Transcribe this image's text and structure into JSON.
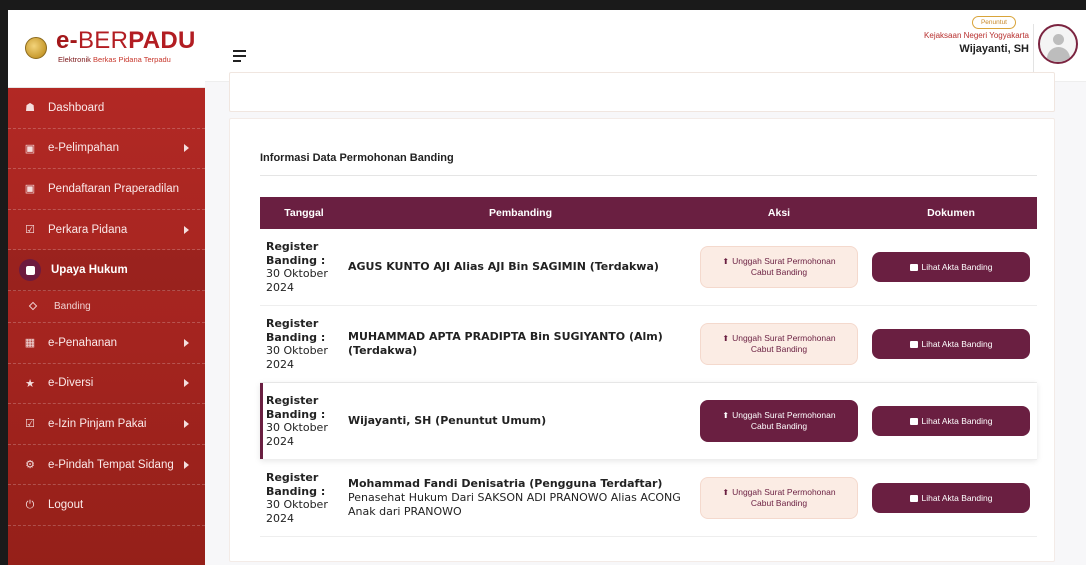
{
  "brand": {
    "title_pre": "e-",
    "title_mid": "BER",
    "title_end": "PADU",
    "subtitle_part1": "Elektronik ",
    "subtitle_part2": "Berkas Pidana Terpadu"
  },
  "sidebar": {
    "items": [
      {
        "label": "Dashboard",
        "icon": "home-icon"
      },
      {
        "label": "e-Pelimpahan",
        "icon": "file-icon"
      },
      {
        "label": "Pendaftaran Praperadilan",
        "icon": "file-icon"
      },
      {
        "label": "Perkara Pidana",
        "icon": "check-icon"
      },
      {
        "label": "Upaya Hukum",
        "icon": "file-icon"
      },
      {
        "label": "Banding",
        "icon": "diamond-icon"
      },
      {
        "label": "e-Penahanan",
        "icon": "grid-icon"
      },
      {
        "label": "e-Diversi",
        "icon": "star-icon"
      },
      {
        "label": "e-Izin Pinjam Pakai",
        "icon": "check-icon"
      },
      {
        "label": "e-Pindah Tempat Sidang",
        "icon": "gear-icon"
      },
      {
        "label": "Logout",
        "icon": "power-icon"
      }
    ]
  },
  "header": {
    "role": "Penuntut",
    "org": "Kejaksaan Negeri Yogyakarta",
    "user": "Wijayanti, SH"
  },
  "main": {
    "section_title": "Informasi Data Permohonan Banding",
    "columns": [
      "Tanggal",
      "Pembanding",
      "Aksi",
      "Dokumen"
    ],
    "rows": [
      {
        "date_label": "Register Banding :",
        "date": "30 Oktober 2024",
        "name": "AGUS KUNTO AJI Alias AJI Bin SAGIMIN (Terdakwa)",
        "sub": "",
        "upload_line1": "Unggah Surat Permohonan",
        "upload_line2": "Cabut Banding",
        "akta": "Lihat Akta Banding"
      },
      {
        "date_label": "Register Banding :",
        "date": "30 Oktober 2024",
        "name": "MUHAMMAD APTA PRADIPTA Bin SUGIYANTO (Alm) (Terdakwa)",
        "sub": "",
        "upload_line1": "Unggah Surat Permohonan",
        "upload_line2": "Cabut Banding",
        "akta": "Lihat Akta Banding"
      },
      {
        "date_label": "Register Banding :",
        "date": "30 Oktober 2024",
        "name": "Wijayanti, SH (Penuntut Umum)",
        "sub": "",
        "upload_line1": "Unggah Surat Permohonan",
        "upload_line2": "Cabut Banding",
        "akta": "Lihat Akta Banding"
      },
      {
        "date_label": "Register Banding :",
        "date": "30 Oktober 2024",
        "name": "Mohammad Fandi Denisatria (Pengguna Terdaftar)",
        "sub": "Penasehat Hukum Dari SAKSON ADI PRANOWO Alias ACONG Anak dari PRANOWO",
        "upload_line1": "Unggah Surat Permohonan",
        "upload_line2": "Cabut Banding",
        "akta": "Lihat Akta Banding"
      }
    ]
  },
  "colors": {
    "primary": "#6a1f41",
    "sidebar": "#b62a26",
    "upload_light": "#fbece4"
  }
}
